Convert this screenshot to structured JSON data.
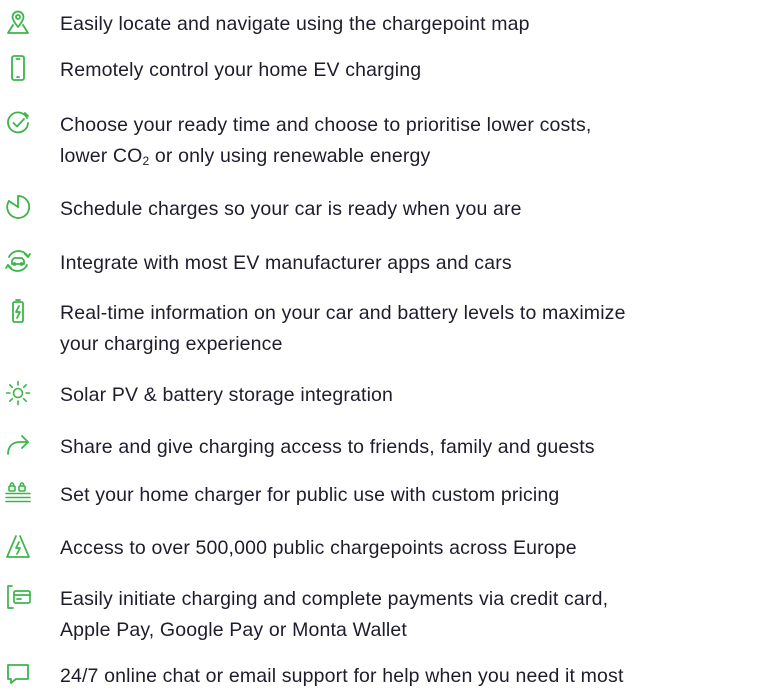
{
  "accent_color": "#3cb54a",
  "text_color": "#1d1d2c",
  "features": [
    {
      "icon": "map-pin-icon",
      "lines": [
        "Easily locate and navigate using the chargepoint map"
      ]
    },
    {
      "icon": "smartphone-icon",
      "lines": [
        "Remotely control your home EV charging"
      ]
    },
    {
      "icon": "clock-check-icon",
      "lines": [
        "Choose your ready time and choose to prioritise lower costs,",
        "lower CO",
        "2",
        " or only using renewable energy"
      ]
    },
    {
      "icon": "schedule-clock-icon",
      "lines": [
        "Schedule charges so your car is ready when you are"
      ]
    },
    {
      "icon": "car-sync-icon",
      "lines": [
        "Integrate with most EV manufacturer apps and cars"
      ]
    },
    {
      "icon": "battery-bolt-icon",
      "lines": [
        "Real-time information on your car and battery levels to maximize",
        "your charging experience"
      ]
    },
    {
      "icon": "sun-icon",
      "lines": [
        "Solar PV & battery storage integration"
      ]
    },
    {
      "icon": "share-arrow-icon",
      "lines": [
        "Share and give charging access to friends, family and guests"
      ]
    },
    {
      "icon": "public-charger-icon",
      "lines": [
        "Set your home charger for public use with custom pricing"
      ]
    },
    {
      "icon": "road-bolt-icon",
      "lines": [
        "Access to over 500,000 public chargepoints across Europe"
      ]
    },
    {
      "icon": "payment-card-icon",
      "lines": [
        "Easily initiate charging and complete payments via credit card,",
        "Apple Pay, Google Pay or Monta Wallet"
      ]
    },
    {
      "icon": "chat-bubble-icon",
      "lines": [
        "24/7 online chat or email support for help when you need it most"
      ]
    }
  ]
}
